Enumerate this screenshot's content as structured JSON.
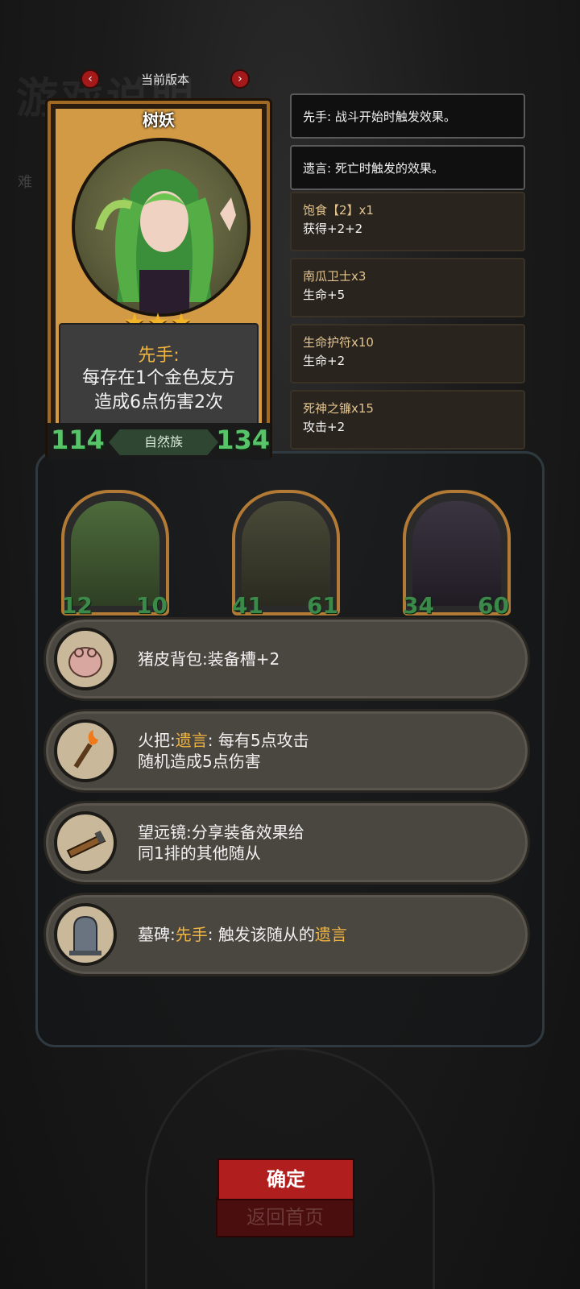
{
  "background": {
    "ghost_title": "游戏说明",
    "ghost_subtitle": "难"
  },
  "version": {
    "label": "当前版本",
    "prev_icon": "chevron-left-icon",
    "next_icon": "chevron-right-icon"
  },
  "hero": {
    "name": "树妖",
    "stars": "★★★",
    "ability_keyword": "先手:",
    "ability_line1": "每存在1个金色友方",
    "ability_line2": "造成6点伤害2次",
    "attack": "114",
    "health": "134",
    "tribe": "自然族"
  },
  "keywords": [
    {
      "text": "先手: 战斗开始时触发效果。"
    },
    {
      "text": "遗言: 死亡时触发的效果。"
    }
  ],
  "buffs": [
    {
      "name": "饱食【2】x1",
      "effect": "获得+2+2"
    },
    {
      "name": "南瓜卫士x3",
      "effect": "生命+5"
    },
    {
      "name": "生命护符x10",
      "effect": "生命+2"
    },
    {
      "name": "死神之镰x15",
      "effect": "攻击+2"
    }
  ],
  "minions": [
    {
      "attack": "12",
      "health": "10"
    },
    {
      "attack": "41",
      "health": "61"
    },
    {
      "attack": "34",
      "health": "60"
    }
  ],
  "equipment": [
    {
      "icon": "backpack-icon",
      "name": "猪皮背包:",
      "desc": "装备槽+2"
    },
    {
      "icon": "torch-icon",
      "name": "火把:",
      "kw": "遗言",
      "desc": ": 每有5点攻击",
      "desc2": "随机造成5点伤害"
    },
    {
      "icon": "telescope-icon",
      "name": "望远镜:",
      "desc": "分享装备效果给",
      "desc2": "同1排的其他随从"
    },
    {
      "icon": "tombstone-icon",
      "name": "墓碑:",
      "kw": "先手",
      "desc": ": 触发该随从的",
      "kw2": "遗言"
    }
  ],
  "buttons": {
    "confirm": "确定",
    "home": "返回首页"
  },
  "colors": {
    "keyword": "#f0b440",
    "stat_green": "#58c46a",
    "confirm_red": "#b01e1e",
    "card_gold": "#d39a45"
  }
}
